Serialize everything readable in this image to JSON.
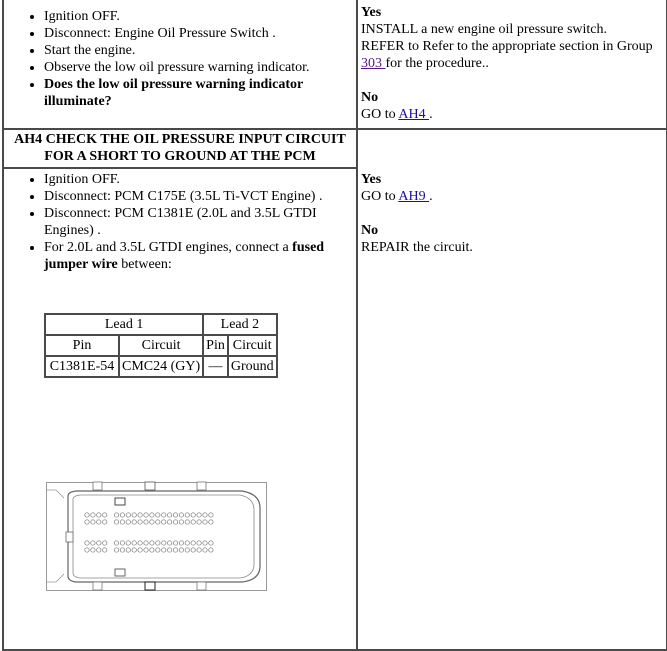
{
  "row1": {
    "steps": [
      {
        "text": "Ignition OFF.",
        "bold": false
      },
      {
        "text": "Disconnect: Engine Oil Pressure Switch .",
        "bold": false
      },
      {
        "text": "Start the engine.",
        "bold": false
      },
      {
        "text": "Observe the low oil pressure warning indicator.",
        "bold": false
      },
      {
        "text": "Does the low oil pressure warning indicator illuminate?",
        "bold": true
      }
    ],
    "yes_label": "Yes",
    "yes_line1": "INSTALL a new engine oil pressure switch.",
    "yes_line2_prefix": "REFER to Refer to the appropriate section in Group ",
    "yes_link": "303 ",
    "yes_line2_suffix": "for the procedure..",
    "no_label": "No",
    "no_prefix": "GO to ",
    "no_link": "AH4 ",
    "no_suffix": "."
  },
  "row2": {
    "heading": "AH4 CHECK THE OIL PRESSURE INPUT CIRCUIT FOR A SHORT TO GROUND AT THE PCM"
  },
  "row3": {
    "steps": {
      "s1": "Ignition OFF.",
      "s2": "Disconnect: PCM C175E (3.5L Ti-VCT Engine) .",
      "s3": "Disconnect: PCM C1381E (2.0L and 3.5L GTDI Engines) .",
      "s4_prefix": "For 2.0L and 3.5L GTDI engines, connect a ",
      "s4_bold": "fused jumper wire",
      "s4_suffix": " between:"
    },
    "pin_table": {
      "group_headers": [
        "Lead 1",
        "Lead 2"
      ],
      "column_headers": [
        "Pin",
        "Circuit",
        "Pin",
        "Circuit"
      ],
      "rows": [
        [
          "C1381E-54",
          "CMC24 (GY)",
          "—",
          "Ground"
        ]
      ]
    },
    "connector_icon": "pcm-connector-diagram",
    "yes_label": "Yes",
    "yes_prefix": "GO to ",
    "yes_link": "AH9 ",
    "yes_suffix": ".",
    "no_label": "No",
    "no_text": "REPAIR the circuit."
  }
}
